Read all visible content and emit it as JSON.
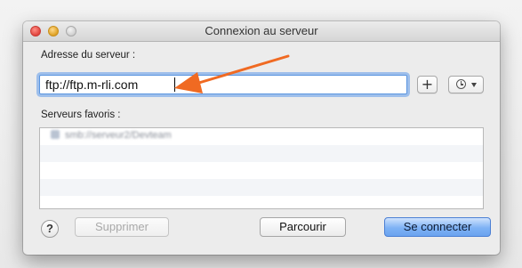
{
  "window": {
    "title": "Connexion au serveur"
  },
  "address": {
    "label": "Adresse du serveur :",
    "value": "ftp://ftp.m-rli.com"
  },
  "controls": {
    "add_label": "+",
    "history_icon": "clock-icon",
    "history_menu_icon": "chevron-down-icon"
  },
  "favorites": {
    "label": "Serveurs favoris :",
    "items": [
      {
        "label": "smb://serveur2/Devteam",
        "icon": "server-icon"
      }
    ]
  },
  "buttons": {
    "help": "?",
    "delete": "Supprimer",
    "browse": "Parcourir",
    "connect": "Se connecter"
  },
  "colors": {
    "annotation_arrow": "#f06a22",
    "focus_ring": "#5f9beb",
    "default_button": "#7eb2f5"
  }
}
